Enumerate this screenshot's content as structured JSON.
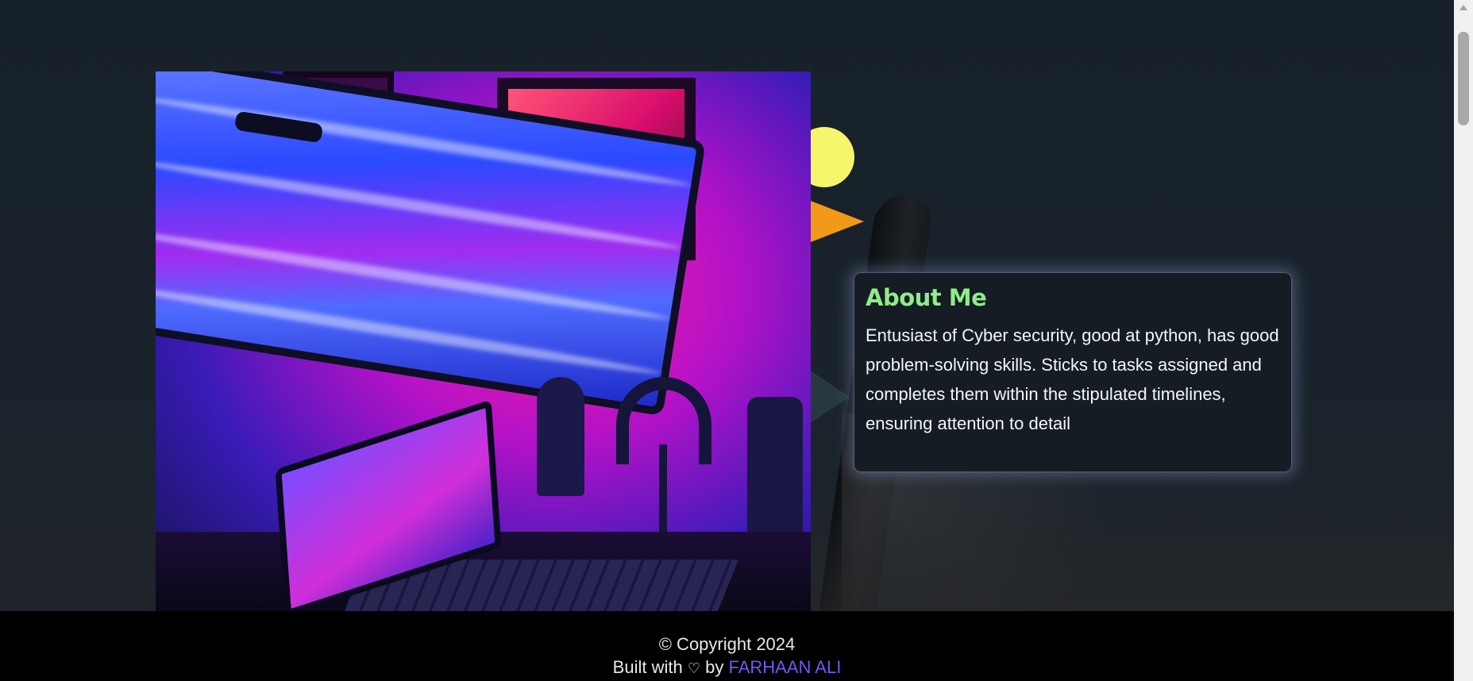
{
  "about": {
    "title": "About Me",
    "text": "Entusiast of Cyber security, good at python, has good problem-solving skills. Sticks to tasks assigned and completes them within the stipulated timelines, ensuring attention to detail"
  },
  "footer": {
    "copyright": "© Copyright 2024",
    "built_prefix": "Built with",
    "heart": "♡",
    "by": "by",
    "author": "FARHAAN ALI"
  },
  "colors": {
    "title_accent": "#8fec8a",
    "author_link": "#6f5cf0",
    "background": "#18212a",
    "footer_bg": "#000000"
  },
  "icons": {
    "heart": "heart-icon",
    "scroll_up": "scroll-up-arrow-icon"
  }
}
